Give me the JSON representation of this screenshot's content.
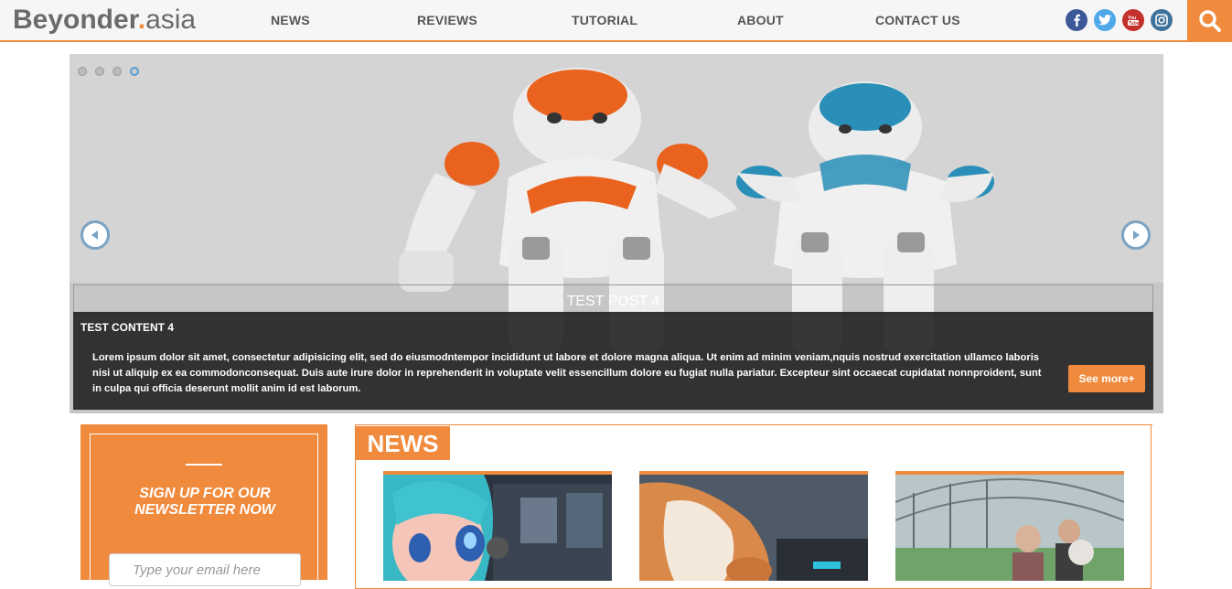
{
  "header": {
    "logo_main": "Beyonder",
    "logo_dot": ".",
    "logo_suffix": "asia",
    "nav": [
      "NEWS",
      "REVIEWS",
      "TUTORIAL",
      "ABOUT",
      "CONTACT US"
    ],
    "social": [
      {
        "name": "facebook-icon",
        "glyph": "f",
        "color": "#3b5998"
      },
      {
        "name": "twitter-icon",
        "glyph": "t",
        "color": "#4fa8e8"
      },
      {
        "name": "youtube-icon",
        "glyph": "▶",
        "color": "#c4302b"
      },
      {
        "name": "instagram-icon",
        "glyph": "◎",
        "color": "#3f729b"
      }
    ],
    "accent_color": "#f08a3c"
  },
  "slider": {
    "slide_count": 4,
    "active_slide": 4,
    "post_title": "TEST POST 4",
    "content_title": "TEST CONTENT 4",
    "content_text": "Lorem ipsum dolor sit amet, consectetur adipisicing elit, sed do eiusmodntempor incididunt ut labore et dolore magna aliqua. Ut enim ad minim veniam,nquis nostrud exercitation ullamco laboris nisi ut aliquip ex ea commodonconsequat. Duis aute irure dolor in reprehenderit in voluptate velit essencillum dolore eu fugiat nulla pariatur. Excepteur sint occaecat cupidatat nonnproident, sunt in culpa qui officia deserunt mollit anim id est laborum.",
    "see_more_label": "See more+"
  },
  "newsletter": {
    "title_line1": "SIGN UP FOR OUR",
    "title_line2": "NEWSLETTER NOW",
    "email_placeholder": "Type your email here"
  },
  "news": {
    "section_label": "NEWS"
  }
}
